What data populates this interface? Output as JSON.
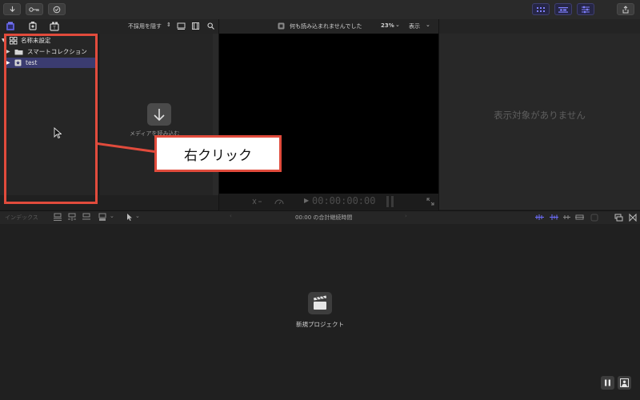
{
  "browser": {
    "filter_label": "不採用を隠す",
    "library_name": "名称未設定",
    "smart_collection": "スマートコレクション",
    "event_name": "test",
    "import_prompt": "メディアを読み込む"
  },
  "viewer": {
    "status_text": "何も読み込まれませんでした",
    "zoom": "23%",
    "view_menu": "表示",
    "timecode": "00:00:00:00"
  },
  "inspector": {
    "empty_text": "表示対象がありません"
  },
  "timeline": {
    "index_label": "インデックス",
    "duration_text": "00:00 の合計継続時間",
    "new_project_label": "新規プロジェクト"
  },
  "annotation": {
    "callout_text": "右クリック",
    "callout_color": "#e14b3c"
  }
}
